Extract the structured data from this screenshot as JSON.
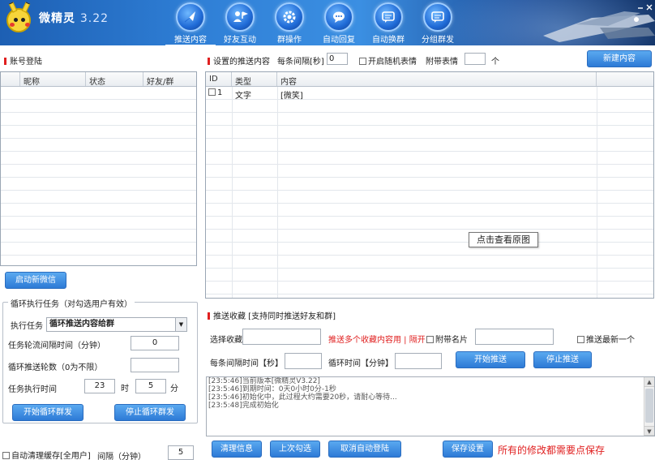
{
  "app": {
    "title": "微精灵",
    "version": "3.22"
  },
  "nav": [
    {
      "label": "推送内容",
      "icon": "paper-plane-icon",
      "active": true
    },
    {
      "label": "好友互动",
      "icon": "user-flag-icon",
      "active": false
    },
    {
      "label": "群操作",
      "icon": "gear-icon",
      "active": false
    },
    {
      "label": "自动回复",
      "icon": "chat-bubble-icon",
      "active": false
    },
    {
      "label": "自动换群",
      "icon": "chat-lines-icon",
      "active": false
    },
    {
      "label": "分组群发",
      "icon": "chat-lines-icon",
      "active": false
    }
  ],
  "account": {
    "title": "账号登陆",
    "columns": [
      "昵称",
      "状态",
      "好友/群"
    ],
    "start_button": "启动新微信"
  },
  "push": {
    "title": "设置的推送内容",
    "interval_label": "每条间隔[秒]",
    "interval_value": "0",
    "random_emoji_label": "开启随机表情",
    "attach_emoji_label": "附带表情",
    "attach_emoji_value": "",
    "attach_emoji_unit": "个",
    "new_button": "新建内容",
    "columns": [
      "ID",
      "类型",
      "内容"
    ],
    "rows": [
      {
        "id": "1",
        "type": "文字",
        "content": "[微笑]"
      }
    ]
  },
  "tooltip": "点击查看原图",
  "loop": {
    "title": "循环执行任务（对勾选用户有效）",
    "task_label": "执行任务",
    "task_value": "循环推送内容给群",
    "rotate_label": "任务轮流间隔时间（分钟）",
    "rotate_value": "0",
    "rounds_label": "循环推送轮数（0为不限）",
    "rounds_value": "",
    "time_label": "任务执行时间",
    "hour_value": "23",
    "hour_unit": "时",
    "minute_value": "5",
    "minute_unit": "分",
    "start_button": "开始循环群发",
    "stop_button": "停止循环群发"
  },
  "favorites": {
    "title": "推送收藏 [支持同时推送好友和群]",
    "select_label": "选择收藏",
    "select_value": "",
    "hint": "推送多个收藏内容用 | 隔开",
    "card_label": "附带名片",
    "card_value": "",
    "latest_label": "推送最新一个",
    "interval_label": "每条间隔时间【秒】",
    "interval_value": "",
    "loop_label": "循环时间【分钟】",
    "loop_value": "",
    "start_button": "开始推送",
    "stop_button": "停止推送"
  },
  "log": {
    "lines": [
      "[23:5:46]当前版本[微精灵V3.22]",
      "[23:5:46]到期时间：0天0小时0分-1秒",
      "[23:5:46]初始化中，此过程大约需要20秒，请耐心等待...",
      "[23:5:48]完成初始化"
    ]
  },
  "footer": {
    "auto_clear_label": "自动清理缓存[全用户]",
    "interval_label": "间隔（分钟）",
    "interval_value": "5",
    "clear_button": "清理信息",
    "last_check_button": "上次勾选",
    "cancel_button": "取消自动登陆",
    "save_button": "保存设置",
    "save_hint": "所有的修改都需要点保存"
  },
  "colors": {
    "accent": "#2d7ad6",
    "alert": "#e02020",
    "header": "#2f7fd6"
  }
}
